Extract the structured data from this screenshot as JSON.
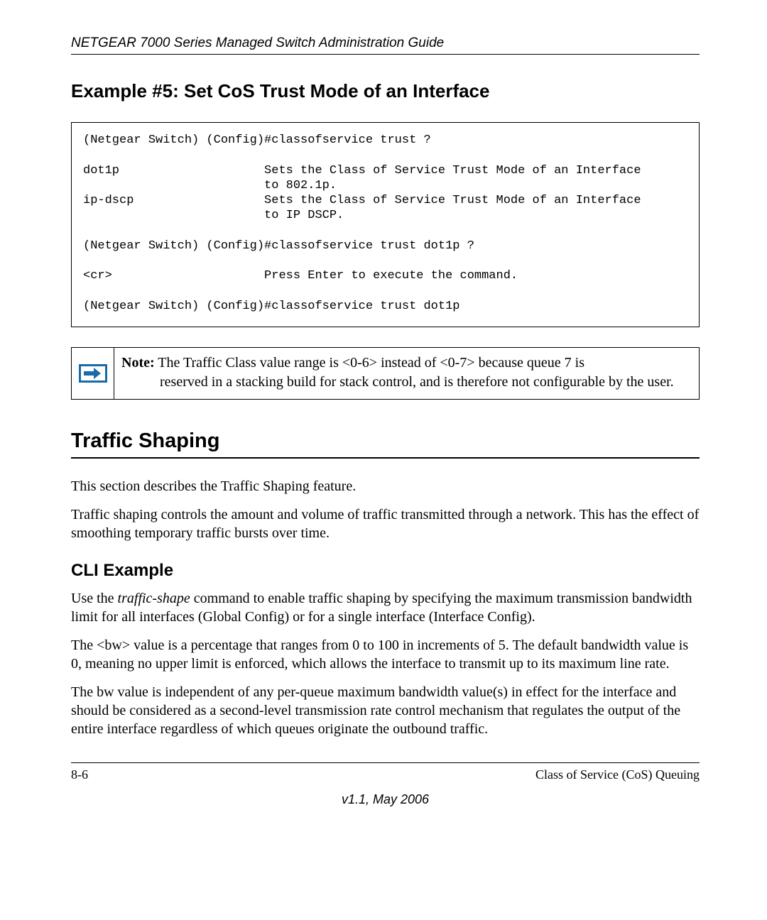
{
  "header": {
    "running": "NETGEAR 7000  Series Managed Switch Administration Guide"
  },
  "section1": {
    "heading": "Example #5: Set CoS Trust Mode of an Interface",
    "code": "(Netgear Switch) (Config)#classofservice trust ?\n\ndot1p                    Sets the Class of Service Trust Mode of an Interface\n                         to 802.1p.\nip-dscp                  Sets the Class of Service Trust Mode of an Interface\n                         to IP DSCP.\n\n(Netgear Switch) (Config)#classofservice trust dot1p ?\n\n<cr>                     Press Enter to execute the command.\n\n(Netgear Switch) (Config)#classofservice trust dot1p"
  },
  "note": {
    "label": "Note:",
    "line1": " The Traffic Class value range is <0-6> instead of <0-7> because queue 7 is",
    "line2": "reserved in a stacking build for stack control, and is therefore not configurable by the user."
  },
  "section2": {
    "heading": "Traffic Shaping",
    "p1": "This section describes the Traffic Shaping feature.",
    "p2": "Traffic shaping controls the amount and volume of traffic transmitted through a network. This has the effect of smoothing temporary traffic bursts over time."
  },
  "section3": {
    "heading": "CLI Example",
    "p1a": "Use the ",
    "p1_em": "traffic-shape",
    "p1b": " command to enable traffic shaping by specifying the maximum transmission bandwidth limit for all interfaces (Global Config) or for a single interface (Interface Config).",
    "p2": "The <bw> value is a percentage that ranges from 0 to 100 in increments of 5. The default bandwidth value is 0, meaning no upper limit is enforced, which allows the interface to transmit up to its maximum line rate.",
    "p3": "The bw value is independent of any per-queue maximum bandwidth value(s) in effect for the interface and should be considered as a second-level transmission rate control mechanism that regulates the output of the entire interface regardless of which queues originate the outbound traffic."
  },
  "footer": {
    "page": "8-6",
    "chapter": "Class of Service (CoS) Queuing",
    "version": "v1.1, May 2006"
  }
}
